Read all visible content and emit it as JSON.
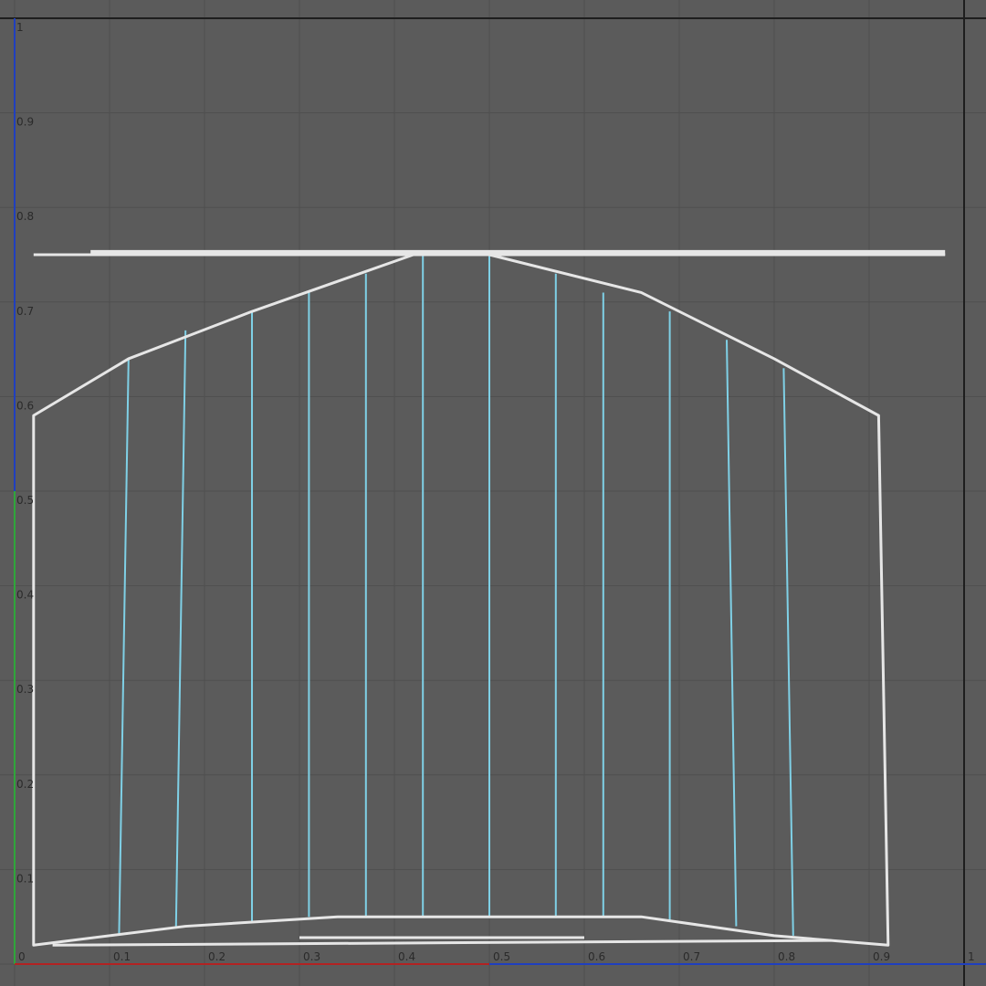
{
  "view": {
    "name": "UV Texture Editor viewport",
    "colors": {
      "background": "#5b5b5b",
      "grid_line": "#4f4f4f",
      "border_line": "#1e1e1e",
      "u_axis": "#b22222",
      "v_axis_upper": "#1f3fbf",
      "v_axis_lower": "#2fa63a",
      "shell_edge": "#e6e6e6",
      "seam_edge": "#7fd0e6",
      "tick_text": "#2a2a2a"
    }
  },
  "axes": {
    "u_ticks": [
      "0",
      "0.1",
      "0.2",
      "0.3",
      "0.4",
      "0.5",
      "0.6",
      "0.7",
      "0.8",
      "0.9",
      "1"
    ],
    "v_ticks": [
      "1",
      "0.9",
      "0.8",
      "0.7",
      "0.6",
      "0.5",
      "0.4",
      "0.3",
      "0.2",
      "0.1"
    ]
  },
  "uv_shells": {
    "main_shell_outline": [
      [
        0.02,
        0.02
      ],
      [
        0.02,
        0.58
      ],
      [
        0.12,
        0.64
      ],
      [
        0.25,
        0.69
      ],
      [
        0.42,
        0.75
      ],
      [
        0.5,
        0.75
      ],
      [
        0.66,
        0.71
      ],
      [
        0.8,
        0.64
      ],
      [
        0.91,
        0.58
      ],
      [
        0.92,
        0.02
      ],
      [
        0.8,
        0.03
      ],
      [
        0.66,
        0.05
      ],
      [
        0.34,
        0.05
      ],
      [
        0.18,
        0.04
      ]
    ],
    "seams": [
      [
        [
          0.12,
          0.64
        ],
        [
          0.11,
          0.03
        ]
      ],
      [
        [
          0.18,
          0.67
        ],
        [
          0.17,
          0.04
        ]
      ],
      [
        [
          0.25,
          0.69
        ],
        [
          0.25,
          0.045
        ]
      ],
      [
        [
          0.31,
          0.71
        ],
        [
          0.31,
          0.05
        ]
      ],
      [
        [
          0.37,
          0.73
        ],
        [
          0.37,
          0.05
        ]
      ],
      [
        [
          0.43,
          0.75
        ],
        [
          0.43,
          0.05
        ]
      ],
      [
        [
          0.5,
          0.75
        ],
        [
          0.5,
          0.05
        ]
      ],
      [
        [
          0.57,
          0.73
        ],
        [
          0.57,
          0.05
        ]
      ],
      [
        [
          0.62,
          0.71
        ],
        [
          0.62,
          0.05
        ]
      ],
      [
        [
          0.69,
          0.69
        ],
        [
          0.69,
          0.045
        ]
      ],
      [
        [
          0.75,
          0.66
        ],
        [
          0.76,
          0.04
        ]
      ],
      [
        [
          0.81,
          0.63
        ],
        [
          0.82,
          0.03
        ]
      ]
    ],
    "strip_top": [
      [
        0.02,
        0.75
      ],
      [
        0.98,
        0.75
      ]
    ],
    "strip_top_thick": [
      [
        0.08,
        0.752
      ],
      [
        0.98,
        0.752
      ]
    ],
    "strip_bottom": [
      [
        0.04,
        0.02
      ],
      [
        0.86,
        0.025
      ]
    ],
    "strip_bottom_inner": [
      [
        0.3,
        0.028
      ],
      [
        0.6,
        0.028
      ]
    ]
  }
}
